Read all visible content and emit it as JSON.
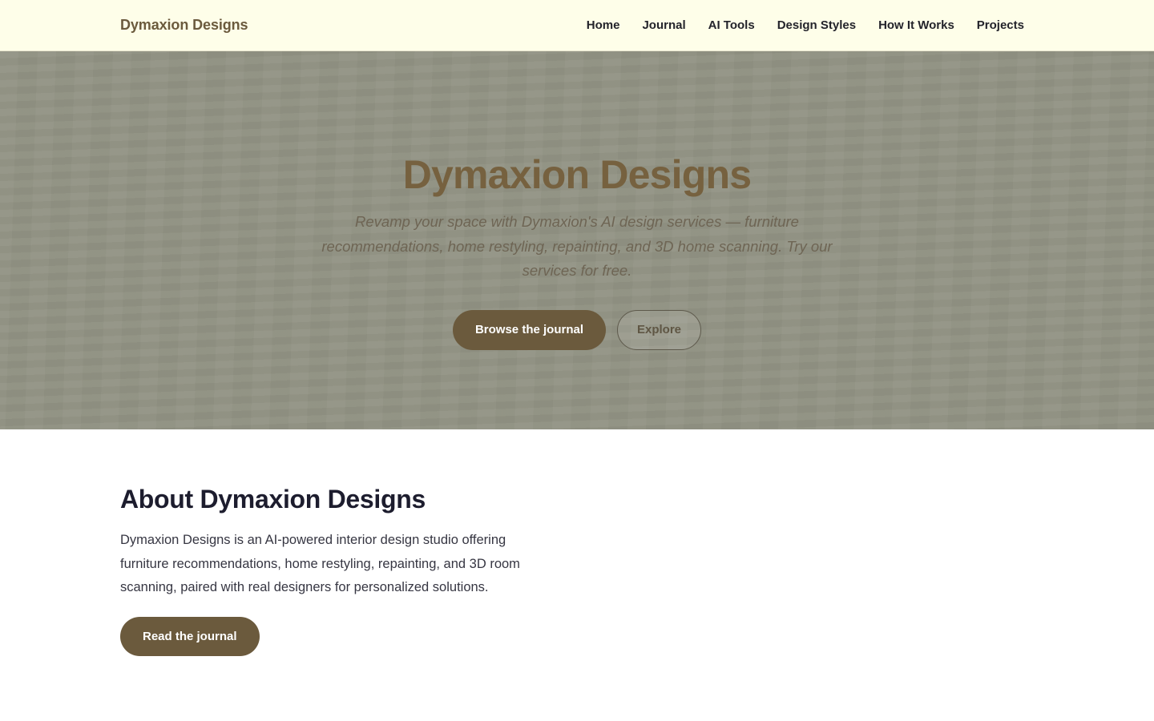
{
  "brand": {
    "name": "Dymaxion Designs"
  },
  "nav": {
    "items": [
      {
        "label": "Home"
      },
      {
        "label": "Journal"
      },
      {
        "label": "AI Tools"
      },
      {
        "label": "Design Styles"
      },
      {
        "label": "How It Works"
      },
      {
        "label": "Projects"
      }
    ]
  },
  "hero": {
    "title": "Dymaxion Designs",
    "subtitle": "Revamp your space with Dymaxion's AI design services — furniture recommendations, home restyling, repainting, and 3D home scanning. Try our services for free.",
    "primary_button": "Browse the journal",
    "secondary_button": "Explore"
  },
  "about": {
    "title": "About Dymaxion Designs",
    "text": "Dymaxion Designs is an AI-powered interior design studio offering furniture recommendations, home restyling, repainting, and 3D room scanning, paired with real designers for personalized solutions.",
    "button": "Read the journal"
  },
  "colors": {
    "nav_background": "#fefee9",
    "brand": "#6b5a3d",
    "hero_background": "#929384",
    "hero_title": "#76613f",
    "button_primary": "#6b5a3d",
    "heading_dark": "#1d1d2e"
  }
}
